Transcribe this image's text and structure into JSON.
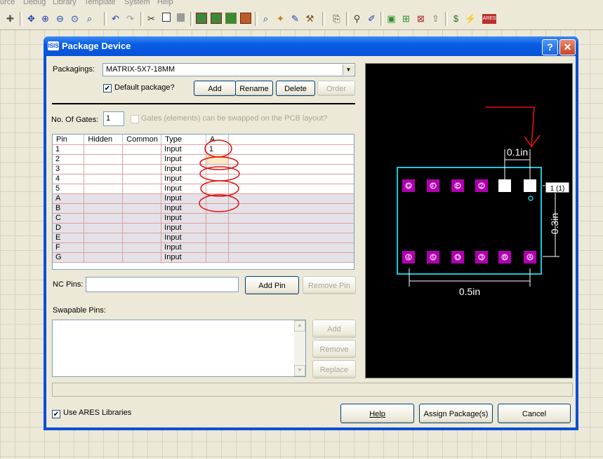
{
  "menu": [
    "urce",
    "Debug",
    "Library",
    "Template",
    "System",
    "Help"
  ],
  "toolbar": {
    "icons": [
      "crosshair-icon",
      "move-icon",
      "zoom-in-icon",
      "zoom-out-icon",
      "zoom-all-icon",
      "zoom-area-icon",
      "undo-icon",
      "redo-icon",
      "cut-icon",
      "copy-icon",
      "paste-icon",
      "block-copy-icon",
      "block-move-icon",
      "block-rotate-icon",
      "block-delete-icon",
      "pick-device-icon",
      "make-device-icon",
      "packaging-tool-icon",
      "decompose-icon",
      "wire-autorouter-icon",
      "search-tag-icon",
      "property-assignment-icon",
      "new-sheet-icon",
      "add-sheet-icon",
      "remove-sheet-icon",
      "exit-to-parent-icon",
      "bill-of-materials-icon",
      "electrical-rule-check-icon",
      "netlist-to-ares-icon"
    ],
    "ares_label": "ARES"
  },
  "dialog": {
    "title": "Package Device",
    "icon_label": "ISIS",
    "help_glyph": "?",
    "close_glyph": "✕"
  },
  "packagings": {
    "label": "Packagings:",
    "value": "MATRIX-5X7-18MM",
    "default_checked": true,
    "default_label": "Default package?",
    "buttons": {
      "add": "Add",
      "rename": "Rename",
      "delete": "Delete",
      "order": "Order"
    }
  },
  "gates": {
    "label": "No. Of Gates:",
    "value": "1",
    "swap_label": "Gates (elements) can be swapped on the PCB layout?",
    "swap_checked": false
  },
  "pin_table": {
    "columns": [
      "Pin",
      "Hidden",
      "Common",
      "Type",
      "A"
    ],
    "rows": [
      {
        "pin": "1",
        "hidden": "",
        "common": "",
        "type": "Input",
        "a": "1"
      },
      {
        "pin": "2",
        "hidden": "",
        "common": "",
        "type": "Input",
        "a": ""
      },
      {
        "pin": "3",
        "hidden": "",
        "common": "",
        "type": "Input",
        "a": ""
      },
      {
        "pin": "4",
        "hidden": "",
        "common": "",
        "type": "Input",
        "a": ""
      },
      {
        "pin": "5",
        "hidden": "",
        "common": "",
        "type": "Input",
        "a": ""
      },
      {
        "pin": "A",
        "hidden": "",
        "common": "",
        "type": "Input",
        "a": ""
      },
      {
        "pin": "B",
        "hidden": "",
        "common": "",
        "type": "Input",
        "a": ""
      },
      {
        "pin": "C",
        "hidden": "",
        "common": "",
        "type": "Input",
        "a": ""
      },
      {
        "pin": "D",
        "hidden": "",
        "common": "",
        "type": "Input",
        "a": ""
      },
      {
        "pin": "E",
        "hidden": "",
        "common": "",
        "type": "Input",
        "a": ""
      },
      {
        "pin": "F",
        "hidden": "",
        "common": "",
        "type": "Input",
        "a": ""
      },
      {
        "pin": "G",
        "hidden": "",
        "common": "",
        "type": "Input",
        "a": ""
      }
    ]
  },
  "nc_pins": {
    "label": "NC Pins:",
    "value": "",
    "add_button": "Add Pin",
    "remove_button": "Remove Pin"
  },
  "swapable": {
    "label": "Swapable Pins:",
    "buttons": {
      "add": "Add",
      "remove": "Remove",
      "replace": "Replace"
    }
  },
  "preview": {
    "top_pads": [
      "G",
      "F",
      "E",
      "2",
      "",
      ""
    ],
    "bottom_pads": [
      "4",
      "5",
      "D",
      "3",
      "B",
      "A"
    ],
    "dim_top": "0.1in",
    "dim_right": "0.3in",
    "dim_bottom": "0.5in",
    "pin_tag": "1 (1)"
  },
  "footer": {
    "use_ares_checked": true,
    "use_ares_label": "Use ARES Libraries",
    "help": "Help",
    "assign": "Assign Package(s)",
    "cancel": "Cancel"
  },
  "colors": {
    "annotation": "#e01010",
    "outline": "#18c8d8",
    "pad": "#b000b0"
  }
}
